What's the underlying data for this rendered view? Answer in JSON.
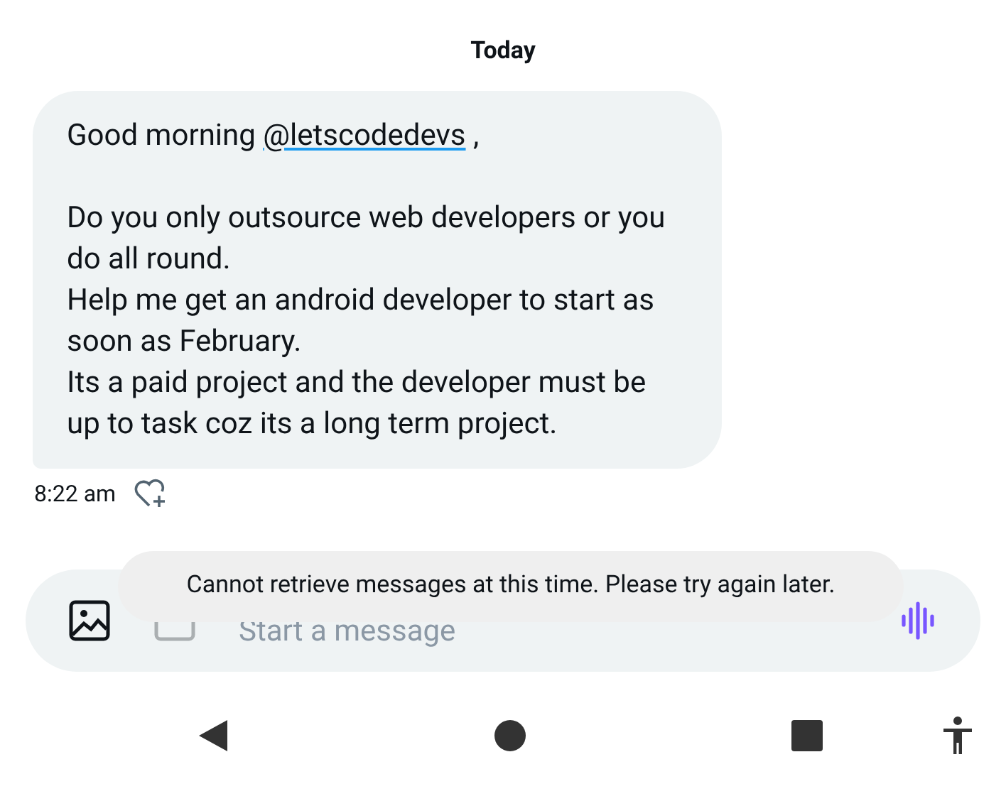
{
  "header": {
    "date": "Today"
  },
  "message": {
    "greeting": "Good morning",
    "mention": "@letscodedevs",
    "greeting_end": ",",
    "paragraphs": [
      "Do you only outsource web developers or you do all round.",
      "Help me get an android developer to start as soon as February.",
      "Its a paid project and the developer must be up to task coz its a long term project."
    ],
    "time": "8:22 am"
  },
  "composer": {
    "placeholder": "Start a message"
  },
  "toast": {
    "text": "Cannot retrieve messages at this time. Please try again later."
  }
}
